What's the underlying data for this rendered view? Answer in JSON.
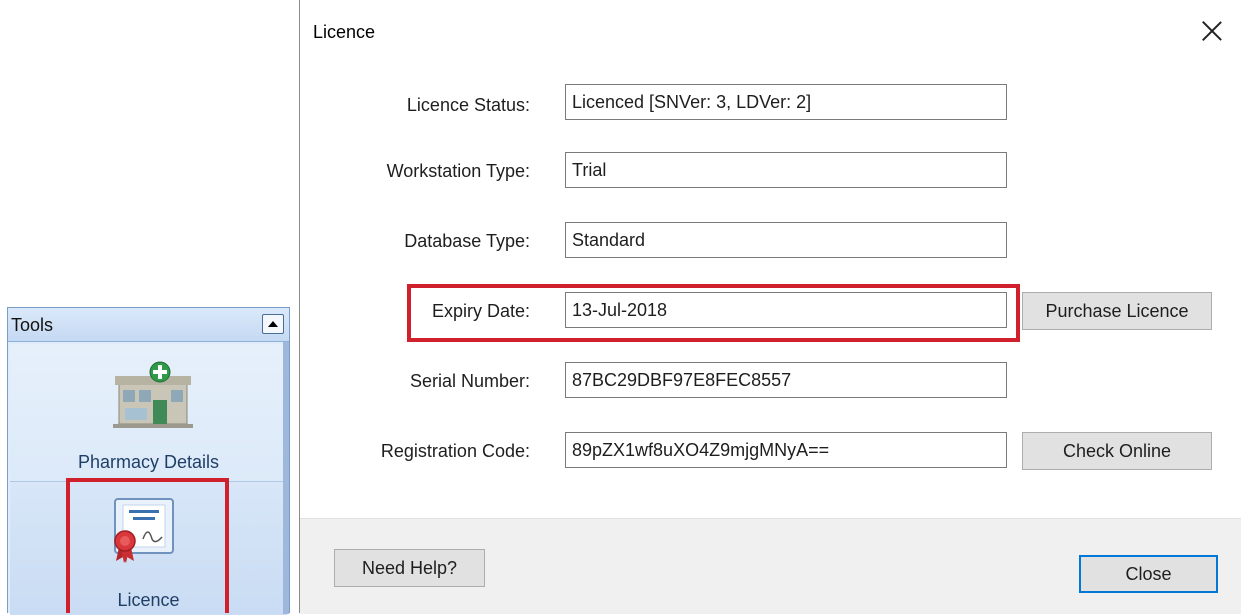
{
  "tools_panel": {
    "title": "Tools",
    "items": [
      {
        "label": "Pharmacy Details",
        "icon": "pharmacy-building-icon"
      },
      {
        "label": "Licence",
        "icon": "licence-certificate-icon",
        "highlighted": true
      }
    ]
  },
  "dialog": {
    "title": "Licence",
    "fields": [
      {
        "label": "Licence Status:",
        "value": "Licenced [SNVer: 3, LDVer: 2]"
      },
      {
        "label": "Workstation Type:",
        "value": "Trial"
      },
      {
        "label": "Database Type:",
        "value": "Standard"
      },
      {
        "label": "Expiry Date:",
        "value": "13-Jul-2018",
        "highlighted": true
      },
      {
        "label": "Serial Number:",
        "value": "87BC29DBF97E8FEC8557"
      },
      {
        "label": "Registration Code:",
        "value": "89pZX1wf8uXO4Z9mjgMNyA=="
      }
    ],
    "purchase_button": "Purchase Licence",
    "check_online_button": "Check Online",
    "help_button": "Need Help?",
    "close_button": "Close"
  },
  "colors": {
    "highlight": "#d0202c",
    "focus_border": "#0078d7",
    "panel_background": "#e0ecf9"
  }
}
